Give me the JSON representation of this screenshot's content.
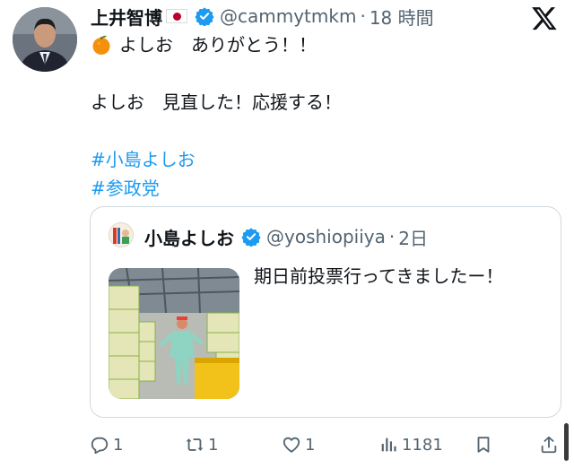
{
  "tweet": {
    "author_name": "上井智博",
    "author_handle": "@cammytmkm",
    "separator": "·",
    "time": "18 時間",
    "lines": [
      {
        "text": "よしお　ありがとう！！"
      },
      {
        "text": ""
      },
      {
        "text": "よしお　見直した！応援する！"
      },
      {
        "text": ""
      }
    ],
    "hashtags": [
      "#小島よしお",
      "#参政党"
    ]
  },
  "quoted": {
    "author_name": "小島よしお",
    "author_handle": "@yoshiopiiya",
    "separator": "·",
    "time": "2日",
    "text": "期日前投票行ってきましたー！"
  },
  "actions": {
    "replies": "1",
    "retweets": "1",
    "likes": "1",
    "views": "1181"
  },
  "icons": {
    "top_right": "x-logo-icon",
    "emoji": "tangerine-icon",
    "flag": "japan-flag-icon",
    "verified": "verified-badge-icon"
  },
  "colors": {
    "accent": "#1d9bf0",
    "secondary_text": "#536471",
    "border": "#cfd9de"
  }
}
